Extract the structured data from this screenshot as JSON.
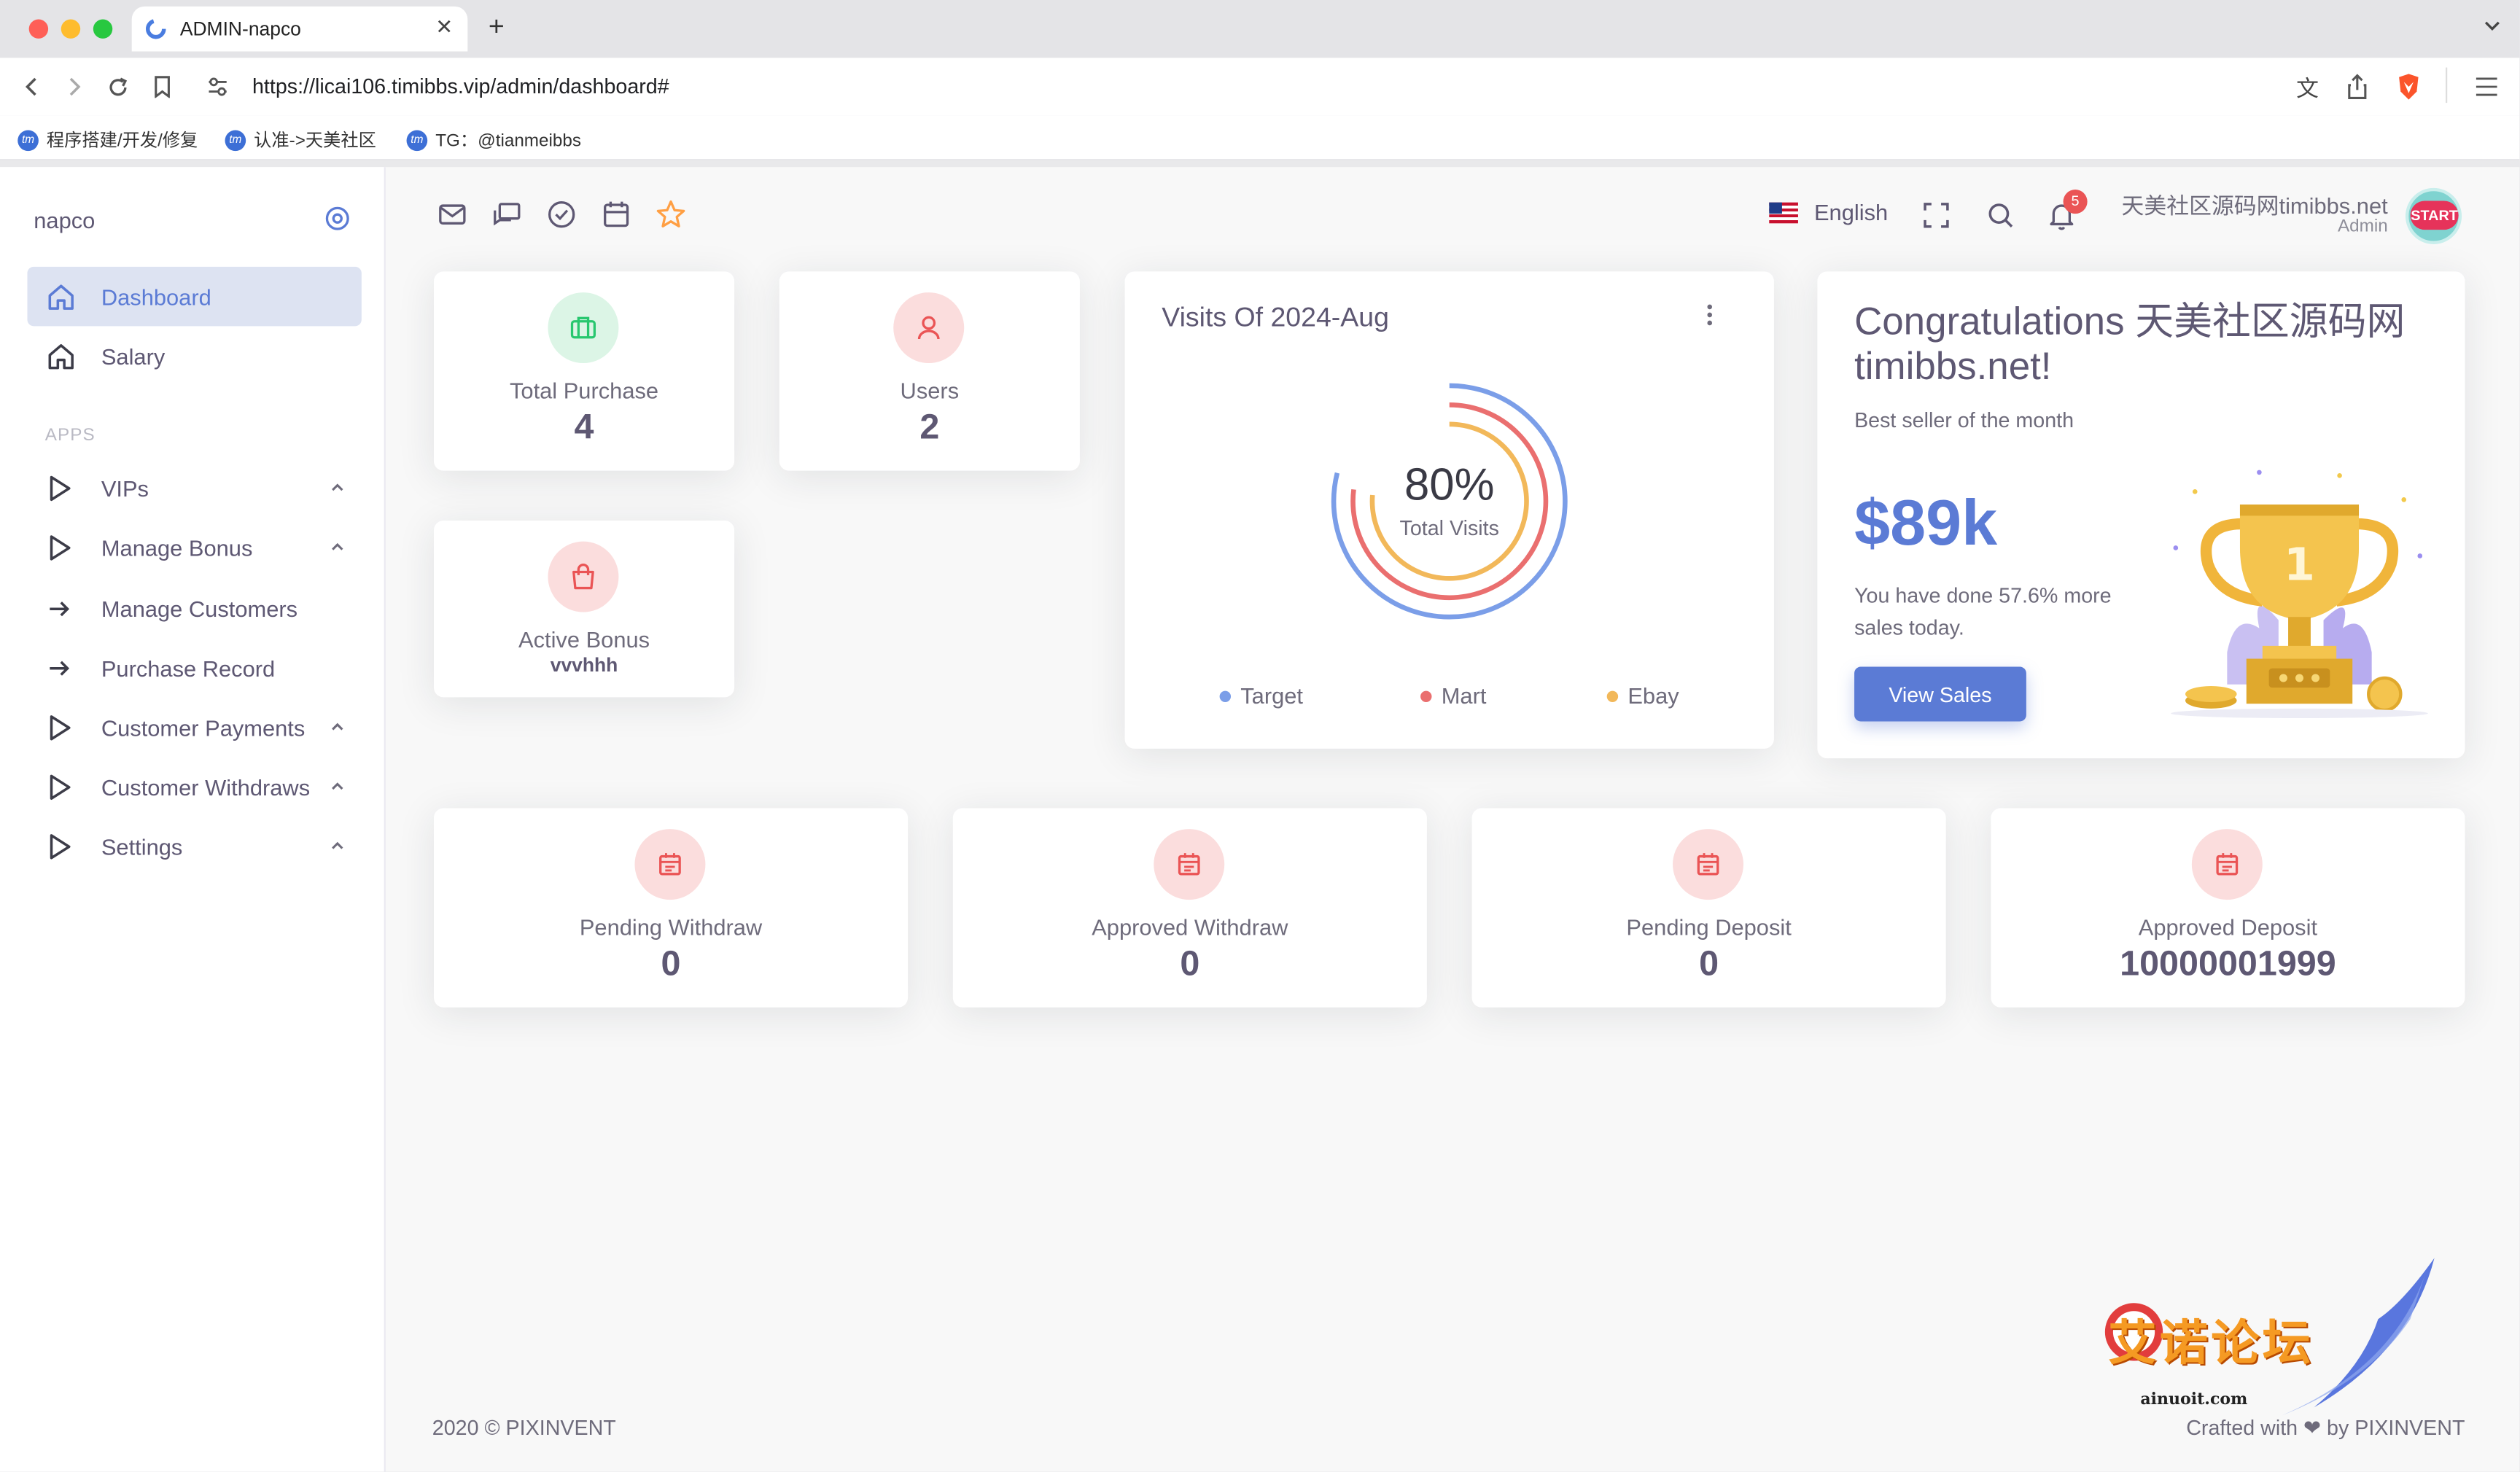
{
  "browser": {
    "tab_title": "ADMIN-napco",
    "url": "https://licai106.timibbs.vip/admin/dashboard#",
    "bookmarks": [
      "程序搭建/开发/修复",
      "认准->天美社区",
      "TG：@tianmeibbs"
    ]
  },
  "sidebar": {
    "brand": "napco",
    "section_label": "APPS",
    "items": [
      {
        "label": "Dashboard",
        "icon": "home-icon",
        "active": true
      },
      {
        "label": "Salary",
        "icon": "home-icon"
      },
      {
        "label": "VIPs",
        "icon": "play-icon",
        "expandable": true
      },
      {
        "label": "Manage Bonus",
        "icon": "play-icon",
        "expandable": true
      },
      {
        "label": "Manage Customers",
        "icon": "arrow-right-icon"
      },
      {
        "label": "Purchase Record",
        "icon": "arrow-right-icon"
      },
      {
        "label": "Customer Payments",
        "icon": "play-icon",
        "expandable": true
      },
      {
        "label": "Customer Withdraws",
        "icon": "play-icon",
        "expandable": true
      },
      {
        "label": "Settings",
        "icon": "play-icon",
        "expandable": true
      }
    ]
  },
  "navbar": {
    "language": "English",
    "notification_count": "5",
    "user_name": "天美社区源码网timibbs.net",
    "user_role": "Admin",
    "avatar_text": "START"
  },
  "stats": {
    "total_purchase": {
      "label": "Total Purchase",
      "value": "4"
    },
    "users": {
      "label": "Users",
      "value": "2"
    },
    "active_bonus": {
      "label": "Active Bonus",
      "value": "vvvhhh"
    }
  },
  "visits": {
    "title": "Visits Of 2024-Aug",
    "percent": "80%",
    "caption": "Total Visits",
    "legend": [
      {
        "name": "Target",
        "color": "#7b9ee8"
      },
      {
        "name": "Mart",
        "color": "#ea6f6f"
      },
      {
        "name": "Ebay",
        "color": "#f2b85a"
      }
    ]
  },
  "congrats": {
    "title": "Congratulations 天美社区源码网timibbs.net!",
    "subtitle": "Best seller of the month",
    "amount": "$89k",
    "text": "You have done 57.6% more sales today.",
    "button": "View Sales"
  },
  "summary": [
    {
      "label": "Pending Withdraw",
      "value": "0"
    },
    {
      "label": "Approved Withdraw",
      "value": "0"
    },
    {
      "label": "Pending Deposit",
      "value": "0"
    },
    {
      "label": "Approved Deposit",
      "value": "10000001999"
    }
  ],
  "footer": {
    "left": "2020 © PIXINVENT",
    "right": "Crafted with ❤ by PIXINVENT"
  },
  "watermark": {
    "text": "艾诺论坛",
    "sub": "ainuoit.com"
  },
  "colors": {
    "primary": "#5b7bd5",
    "danger": "#ea5455",
    "success": "#28c76f",
    "warning": "#ff9f43"
  }
}
